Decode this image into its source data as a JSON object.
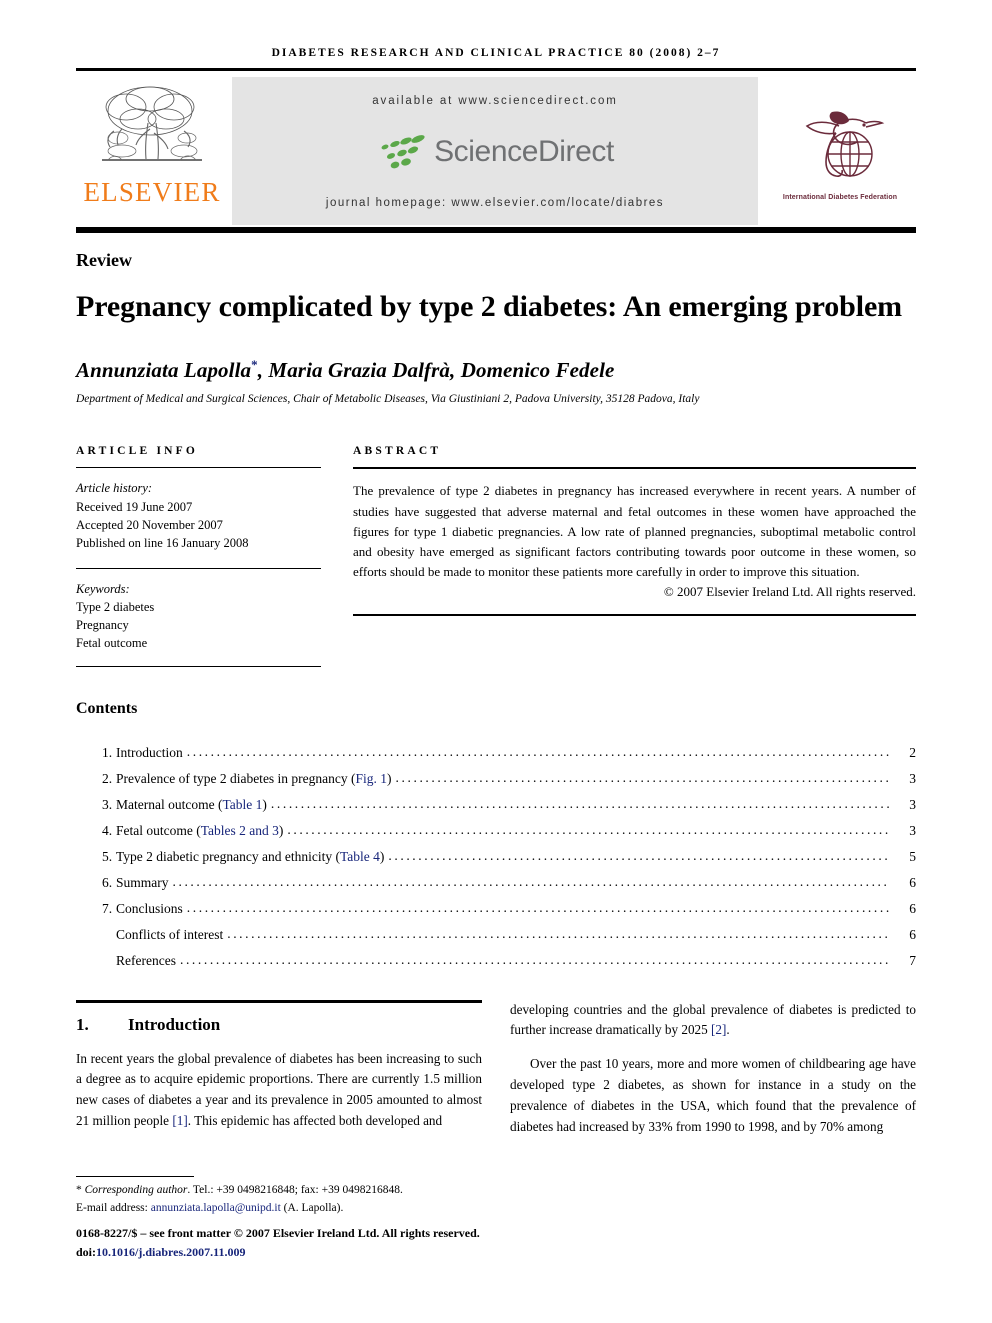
{
  "running_head": "Diabetes research and clinical practice 80 (2008) 2–7",
  "masthead": {
    "publisher_name": "ELSEVIER",
    "available_at": "available at www.sciencedirect.com",
    "sciencedirect_word": "ScienceDirect",
    "journal_homepage": "journal homepage: www.elsevier.com/locate/diabres",
    "society_caption": "International Diabetes Federation",
    "colors": {
      "elsevier_orange": "#F07C1A",
      "sciencedirect_green": "#5BA849",
      "sciencedirect_gray": "#6F7173",
      "idf_maroon": "#6B2B3B",
      "banner_gray": "#E4E4E4",
      "link_blue": "#17257A"
    }
  },
  "article": {
    "doctype": "Review",
    "title": "Pregnancy complicated by type 2 diabetes: An emerging problem",
    "authors": "Annunziata Lapolla",
    "author_star": "*",
    "authors_rest": ", Maria Grazia Dalfrà, Domenico Fedele",
    "affiliation": "Department of Medical and Surgical Sciences, Chair of Metabolic Diseases, Via Giustiniani 2, Padova University, 35128 Padova, Italy"
  },
  "article_info": {
    "label": "Article info",
    "history_label": "Article history:",
    "received": "Received 19 June 2007",
    "accepted": "Accepted 20 November 2007",
    "published": "Published on line 16 January 2008",
    "keywords_label": "Keywords:",
    "keywords": [
      "Type 2 diabetes",
      "Pregnancy",
      "Fetal outcome"
    ]
  },
  "abstract": {
    "label": "Abstract",
    "text": "The prevalence of type 2 diabetes in pregnancy has increased everywhere in recent years. A number of studies have suggested that adverse maternal and fetal outcomes in these women have approached the figures for type 1 diabetic pregnancies. A low rate of planned pregnancies, suboptimal metabolic control and obesity have emerged as significant factors contributing towards poor outcome in these women, so efforts should be made to monitor these patients more carefully in order to improve this situation.",
    "copyright": "© 2007 Elsevier Ireland Ltd. All rights reserved."
  },
  "contents": {
    "heading": "Contents",
    "entries": [
      {
        "num": "1.",
        "label": "Introduction",
        "xref": "",
        "tail": "",
        "page": "2"
      },
      {
        "num": "2.",
        "label": "Prevalence of type 2 diabetes in pregnancy (",
        "xref": "Fig. 1",
        "tail": ")",
        "page": "3"
      },
      {
        "num": "3.",
        "label": "Maternal outcome (",
        "xref": "Table 1",
        "tail": ")",
        "page": "3"
      },
      {
        "num": "4.",
        "label": "Fetal outcome (",
        "xref": "Tables 2 and 3",
        "tail": ")",
        "page": "3"
      },
      {
        "num": "5.",
        "label": "Type 2 diabetic pregnancy and ethnicity (",
        "xref": "Table 4",
        "tail": ")",
        "page": "5"
      },
      {
        "num": "6.",
        "label": "Summary",
        "xref": "",
        "tail": "",
        "page": "6"
      },
      {
        "num": "7.",
        "label": "Conclusions",
        "xref": "",
        "tail": "",
        "page": "6"
      },
      {
        "num": "",
        "label": "Conflicts of interest",
        "xref": "",
        "tail": "",
        "page": "6"
      },
      {
        "num": "",
        "label": "References",
        "xref": "",
        "tail": "",
        "page": "7"
      }
    ]
  },
  "body": {
    "section_number": "1.",
    "section_title": "Introduction",
    "left_para_a": "In recent years the global prevalence of diabetes has been increasing to such a degree as to acquire epidemic proportions. There are currently 1.5 million new cases of diabetes a year and its prevalence in 2005 amounted to almost 21 million people ",
    "left_cite_1": "[1]",
    "left_para_b": ". This epidemic has affected both developed and",
    "right_para_a": "developing countries and the global prevalence of diabetes is predicted to further increase dramatically by 2025 ",
    "right_cite_2": "[2]",
    "right_para_a_tail": ".",
    "right_para_b": "Over the past 10 years, more and more women of childbearing age have developed type 2 diabetes, as shown for instance in a study on the prevalence of diabetes in the USA, which found that the prevalence of diabetes had increased by 33% from 1990 to 1998, and by 70% among"
  },
  "footnote": {
    "star": "*",
    "corresponding": "Corresponding author",
    "tel_fax": ". Tel.: +39 0498216848; fax: +39 0498216848.",
    "email_label": "E-mail address: ",
    "email": "annunziata.lapolla@unipd.it",
    "email_tail": " (A. Lapolla).",
    "issn_line": "0168-8227/$ – see front matter © 2007 Elsevier Ireland Ltd. All rights reserved.",
    "doi_prefix": "doi:",
    "doi": "10.1016/j.diabres.2007.11.009"
  }
}
